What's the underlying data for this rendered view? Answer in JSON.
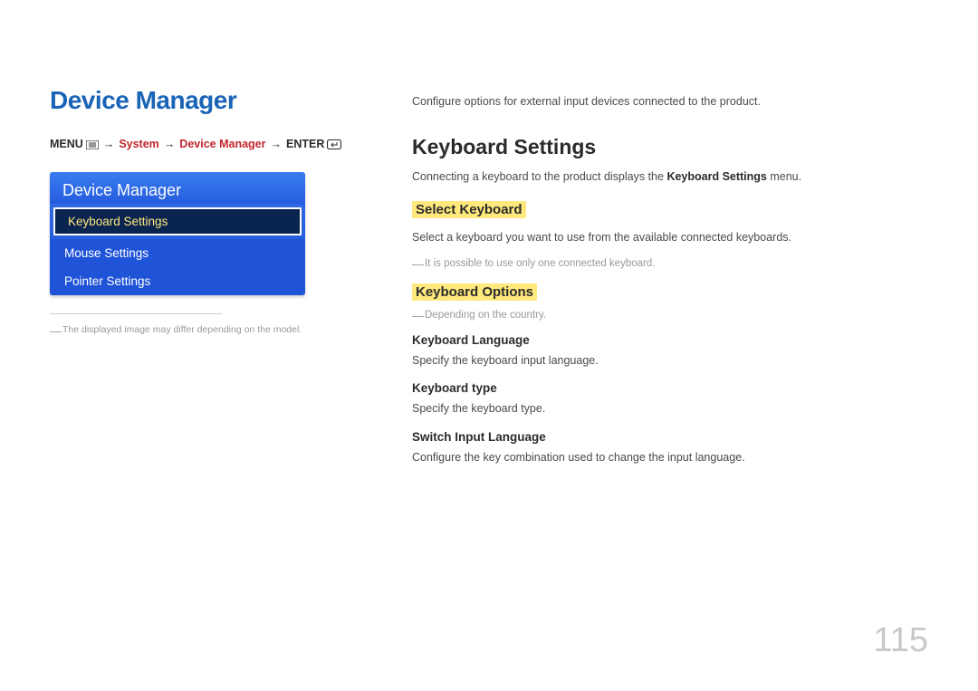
{
  "left": {
    "title": "Device Manager",
    "breadcrumb": {
      "menu": "MENU",
      "system": "System",
      "deviceManager": "Device Manager",
      "enter": "ENTER"
    },
    "panel": {
      "title": "Device Manager",
      "items": [
        {
          "label": "Keyboard Settings",
          "selected": true
        },
        {
          "label": "Mouse Settings",
          "selected": false
        },
        {
          "label": "Pointer Settings",
          "selected": false
        }
      ]
    },
    "footnote": "The displayed image may differ depending on the model."
  },
  "right": {
    "intro": "Configure options for external input devices connected to the product.",
    "h2": "Keyboard Settings",
    "p1_a": "Connecting a keyboard to the product displays the ",
    "p1_b": "Keyboard Settings",
    "p1_c": " menu.",
    "h3a": "Select Keyboard",
    "p2": "Select a keyboard you want to use from the available connected keyboards.",
    "note1": "It is possible to use only one connected keyboard.",
    "h3b": "Keyboard Options",
    "note2": "Depending on the country.",
    "sub1_h": "Keyboard Language",
    "sub1_p": "Specify the keyboard input language.",
    "sub2_h": "Keyboard type",
    "sub2_p": "Specify the keyboard type.",
    "sub3_h": "Switch Input Language",
    "sub3_p": "Configure the key combination used to change the input language."
  },
  "pageNumber": "115"
}
